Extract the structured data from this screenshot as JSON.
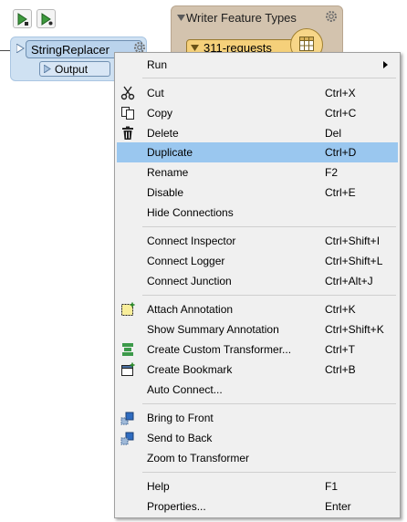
{
  "canvas": {
    "transformer": {
      "name": "StringReplacer",
      "output_port": "Output"
    },
    "writer": {
      "header": "Writer Feature Types",
      "feature_type": "311-requests"
    }
  },
  "menu": {
    "run": {
      "label": "Run"
    },
    "cut": {
      "label": "Cut",
      "shortcut": "Ctrl+X",
      "icon": "scissors-icon"
    },
    "copy": {
      "label": "Copy",
      "shortcut": "Ctrl+C",
      "icon": "copy-icon"
    },
    "delete": {
      "label": "Delete",
      "shortcut": "Del",
      "icon": "trash-icon"
    },
    "duplicate": {
      "label": "Duplicate",
      "shortcut": "Ctrl+D"
    },
    "rename": {
      "label": "Rename",
      "shortcut": "F2"
    },
    "disable": {
      "label": "Disable",
      "shortcut": "Ctrl+E"
    },
    "hide_connections": {
      "label": "Hide Connections"
    },
    "connect_inspector": {
      "label": "Connect Inspector",
      "shortcut": "Ctrl+Shift+I"
    },
    "connect_logger": {
      "label": "Connect Logger",
      "shortcut": "Ctrl+Shift+L"
    },
    "connect_junction": {
      "label": "Connect Junction",
      "shortcut": "Ctrl+Alt+J"
    },
    "attach_annotation": {
      "label": "Attach Annotation",
      "shortcut": "Ctrl+K",
      "icon": "annotation-icon"
    },
    "show_summary_annotation": {
      "label": "Show Summary Annotation",
      "shortcut": "Ctrl+Shift+K"
    },
    "create_custom_transformer": {
      "label": "Create Custom Transformer...",
      "shortcut": "Ctrl+T",
      "icon": "custom-transformer-icon"
    },
    "create_bookmark": {
      "label": "Create Bookmark",
      "shortcut": "Ctrl+B",
      "icon": "bookmark-icon"
    },
    "auto_connect": {
      "label": "Auto Connect..."
    },
    "bring_to_front": {
      "label": "Bring to Front",
      "icon": "bring-to-front-icon"
    },
    "send_to_back": {
      "label": "Send to Back",
      "icon": "send-to-back-icon"
    },
    "zoom_to_transformer": {
      "label": "Zoom to Transformer"
    },
    "help": {
      "label": "Help",
      "shortcut": "F1"
    },
    "properties": {
      "label": "Properties...",
      "shortcut": "Enter"
    }
  },
  "colors": {
    "menu_bg": "#f0f0f0",
    "highlight": "#9ac7ef",
    "transformer_fill": "#cfe1f2",
    "writer_fill": "#d3c3ae",
    "feature_type_fill": "#f5d07a"
  }
}
